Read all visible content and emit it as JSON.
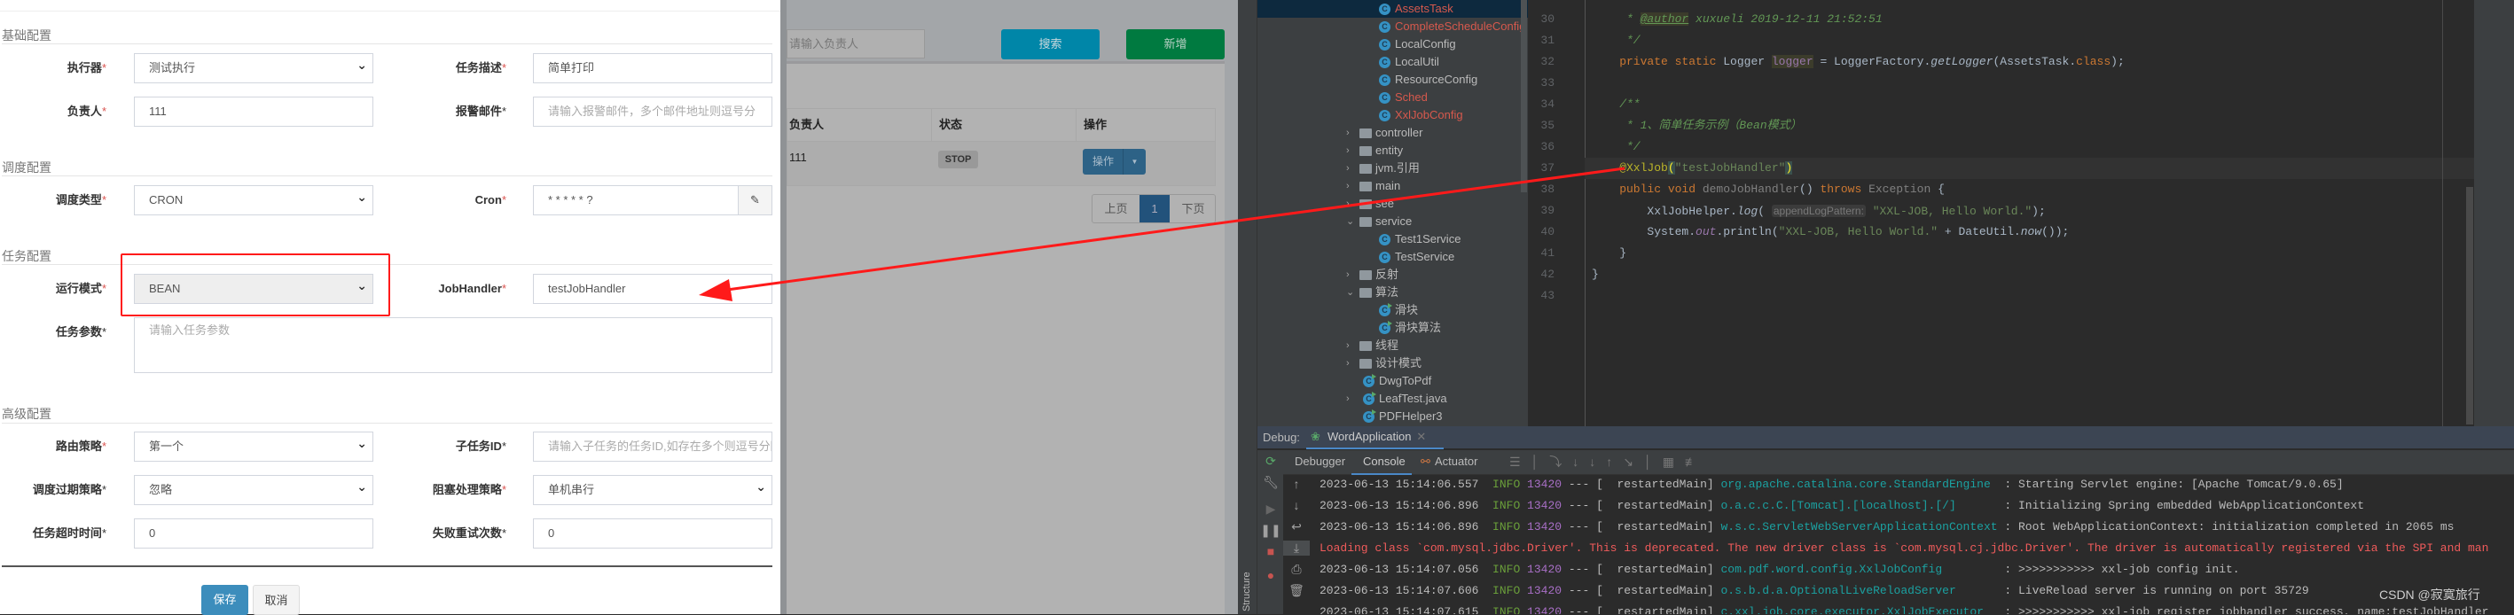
{
  "form": {
    "sections": [
      "基础配置",
      "调度配置",
      "任务配置",
      "高级配置"
    ],
    "fields": {
      "executor": {
        "label": "执行器",
        "value": "测试执行"
      },
      "desc": {
        "label": "任务描述",
        "value": "简单打印"
      },
      "owner": {
        "label": "负责人",
        "value": "111"
      },
      "email": {
        "label": "报警邮件",
        "placeholder": "请输入报警邮件，多个邮件地址则逗号分"
      },
      "schedule_type": {
        "label": "调度类型",
        "value": "CRON"
      },
      "cron": {
        "label": "Cron",
        "value": "* * * * * ?"
      },
      "run_mode": {
        "label": "运行模式",
        "value": "BEAN"
      },
      "job_handler": {
        "label": "JobHandler",
        "value": "testJobHandler"
      },
      "params": {
        "label": "任务参数",
        "placeholder": "请输入任务参数"
      },
      "route": {
        "label": "路由策略",
        "value": "第一个"
      },
      "child": {
        "label": "子任务ID",
        "placeholder": "请输入子任务的任务ID,如存在多个则逗号分隔"
      },
      "misfire": {
        "label": "调度过期策略",
        "value": "忽略"
      },
      "block": {
        "label": "阻塞处理策略",
        "value": "单机串行"
      },
      "timeout": {
        "label": "任务超时时间",
        "value": "0"
      },
      "retry": {
        "label": "失败重试次数",
        "value": "0"
      }
    },
    "required_mark": "*",
    "save": "保存",
    "cancel": "取消"
  },
  "background": {
    "search_placeholder": "请输入负责人",
    "search_button": "搜索",
    "add_button": "新增",
    "columns": [
      "负责人",
      "状态",
      "操作"
    ],
    "row": {
      "owner": "111",
      "status": "STOP",
      "action": "操作"
    },
    "pager": {
      "prev": "上页",
      "page": "1",
      "next": "下页"
    }
  },
  "tree": [
    {
      "name": "AssetsTask",
      "type": "class",
      "modified": true,
      "selected": true
    },
    {
      "name": "CompleteScheduleConfig",
      "type": "class",
      "modified": true
    },
    {
      "name": "LocalConfig",
      "type": "class"
    },
    {
      "name": "LocalUtil",
      "type": "class"
    },
    {
      "name": "ResourceConfig",
      "type": "class"
    },
    {
      "name": "Sched",
      "type": "class",
      "modified": true
    },
    {
      "name": "XxlJobConfig",
      "type": "class",
      "modified": true
    },
    {
      "name": "controller",
      "type": "folder",
      "state": "collapsed"
    },
    {
      "name": "entity",
      "type": "folder",
      "state": "collapsed"
    },
    {
      "name": "jvm.引用",
      "type": "folder",
      "state": "collapsed"
    },
    {
      "name": "main",
      "type": "folder",
      "state": "collapsed"
    },
    {
      "name": "see",
      "type": "folder",
      "state": "collapsed"
    },
    {
      "name": "service",
      "type": "folder",
      "state": "expanded"
    },
    {
      "name": "Test1Service",
      "type": "class"
    },
    {
      "name": "TestService",
      "type": "class"
    },
    {
      "name": "反射",
      "type": "folder",
      "state": "collapsed"
    },
    {
      "name": "算法",
      "type": "folder",
      "state": "expanded"
    },
    {
      "name": "滑块",
      "type": "runclass"
    },
    {
      "name": "滑块算法",
      "type": "runclass"
    },
    {
      "name": "线程",
      "type": "folder",
      "state": "collapsed"
    },
    {
      "name": "设计模式",
      "type": "folder",
      "state": "collapsed"
    },
    {
      "name": "DwgToPdf",
      "type": "runclass",
      "top": true
    },
    {
      "name": "LeafTest.java",
      "type": "runclass",
      "top": true,
      "state": "collapsed"
    },
    {
      "name": "PDFHelper3",
      "type": "runclass",
      "top": true
    }
  ],
  "code": [
    {
      "n": "30",
      "tokens": [
        [
          "     * ",
          "cm"
        ],
        [
          "@author",
          "tag"
        ],
        [
          " xuxueli 2019-12-11 21:52:51",
          "cm"
        ]
      ]
    },
    {
      "n": "31",
      "tokens": [
        [
          "     */",
          "cm"
        ]
      ]
    },
    {
      "n": "32",
      "tokens": [
        [
          "    private static ",
          "kw"
        ],
        [
          "Logger ",
          ""
        ],
        [
          "logger",
          "fld"
        ],
        [
          " = LoggerFactory.",
          ""
        ],
        [
          "getLogger",
          "ital"
        ],
        [
          "(AssetsTask.",
          ""
        ],
        [
          "class",
          "kw"
        ],
        [
          ");",
          ""
        ]
      ]
    },
    {
      "n": "33",
      "tokens": []
    },
    {
      "n": "34",
      "tokens": [
        [
          "    /**",
          "cm"
        ]
      ]
    },
    {
      "n": "35",
      "tokens": [
        [
          "     * 1、简单任务示例（Bean模式）",
          "cm"
        ]
      ]
    },
    {
      "n": "36",
      "tokens": [
        [
          "     */",
          "cm"
        ]
      ]
    },
    {
      "n": "37",
      "tokens": [
        [
          "    @XxlJob",
          "ann"
        ],
        [
          "(",
          "br"
        ],
        [
          "\"testJobHandler\"",
          "str"
        ],
        [
          ")",
          "br"
        ]
      ]
    },
    {
      "n": "38",
      "tokens": [
        [
          "    public void ",
          "kw"
        ],
        [
          "demoJobHandler",
          "dim"
        ],
        [
          "() ",
          ""
        ],
        [
          "throws ",
          "kw"
        ],
        [
          "Exception ",
          "dim"
        ],
        [
          "{",
          ""
        ]
      ]
    },
    {
      "n": "39",
      "tokens": [
        [
          "        XxlJobHelper.",
          ""
        ],
        [
          "log",
          "ital"
        ],
        [
          "( ",
          ""
        ],
        [
          "appendLogPattern:",
          "hint"
        ],
        [
          " \"XXL-JOB, Hello World.\"",
          "str"
        ],
        [
          ");",
          ""
        ]
      ]
    },
    {
      "n": "40",
      "tokens": [
        [
          "        System.",
          ""
        ],
        [
          "out",
          "st"
        ],
        [
          ".println(",
          ""
        ],
        [
          "\"XXL-JOB, Hello World.\"",
          "str"
        ],
        [
          " + DateUtil.",
          ""
        ],
        [
          "now",
          "ital"
        ],
        [
          "());",
          ""
        ]
      ]
    },
    {
      "n": "41",
      "tokens": [
        [
          "    }",
          ""
        ]
      ]
    },
    {
      "n": "42",
      "tokens": [
        [
          "}",
          ""
        ]
      ]
    },
    {
      "n": "43",
      "tokens": []
    }
  ],
  "debug": {
    "title": "Debug:",
    "run_config": "WordApplication",
    "tabs": [
      "Debugger",
      "Console",
      "Actuator"
    ],
    "active_tab": "Console",
    "side_label": "Structure",
    "lines": [
      {
        "ts": "2023-06-13 15:14:06.557",
        "level": "INFO",
        "pid": "13420",
        "thread": "--- [  restartedMain]",
        "logger": "org.apache.catalina.core.StandardEngine ",
        "msg": " : Starting Servlet engine: [Apache Tomcat/9.0.65]"
      },
      {
        "ts": "2023-06-13 15:14:06.896",
        "level": "INFO",
        "pid": "13420",
        "thread": "--- [  restartedMain]",
        "logger": "o.a.c.c.C.[Tomcat].[localhost].[/]      ",
        "msg": " : Initializing Spring embedded WebApplicationContext"
      },
      {
        "ts": "2023-06-13 15:14:06.896",
        "level": "INFO",
        "pid": "13420",
        "thread": "--- [  restartedMain]",
        "logger": "w.s.c.ServletWebServerApplicationContext",
        "msg": " : Root WebApplicationContext: initialization completed in 2065 ms"
      },
      {
        "error": "Loading class `com.mysql.jdbc.Driver'. This is deprecated. The new driver class is `com.mysql.cj.jdbc.Driver'. The driver is automatically registered via the SPI and man"
      },
      {
        "ts": "2023-06-13 15:14:07.056",
        "level": "INFO",
        "pid": "13420",
        "thread": "--- [  restartedMain]",
        "logger": "com.pdf.word.config.XxlJobConfig        ",
        "msg": " : >>>>>>>>>>> xxl-job config init."
      },
      {
        "ts": "2023-06-13 15:14:07.606",
        "level": "INFO",
        "pid": "13420",
        "thread": "--- [  restartedMain]",
        "logger": "o.s.b.d.a.OptionalLiveReloadServer      ",
        "msg": " : LiveReload server is running on port 35729"
      },
      {
        "ts": "2023-06-13 15:14:07.615",
        "level": "INFO",
        "pid": "13420",
        "thread": "--- [  restartedMain]",
        "logger": "c.xxl.job.core.executor.XxlJobExecutor  ",
        "msg": " : >>>>>>>>>>> xxl-job register jobhandler success, name:testJobHandler"
      }
    ]
  },
  "watermark": "CSDN @寂寞旅行",
  "colors": {
    "annotation_red": "#ff1a1a",
    "search": "#0086a8",
    "add": "#007a40",
    "primary": "#3c8dbc",
    "ide_bg": "#2b2b2b"
  }
}
